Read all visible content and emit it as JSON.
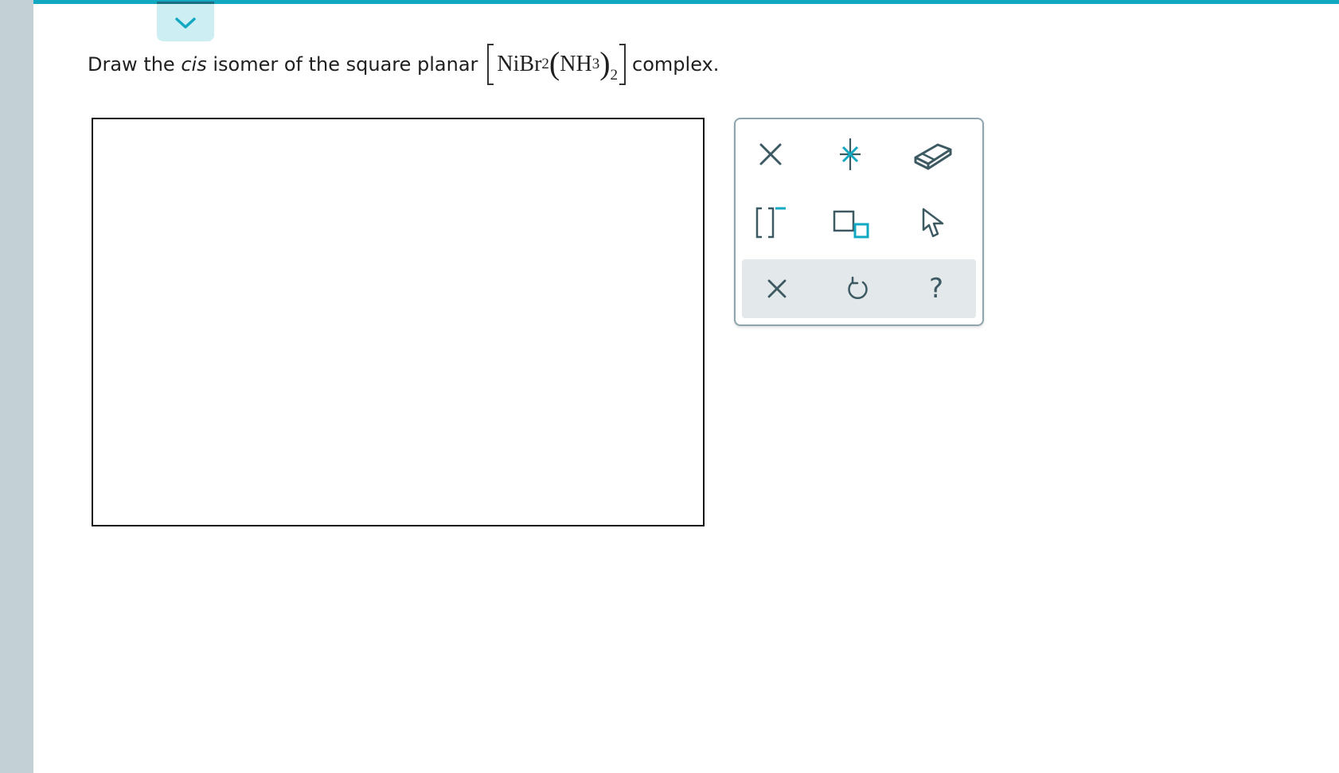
{
  "question": {
    "prefix": "Draw the",
    "italic_word": "cis",
    "middle": "isomer of the square planar",
    "suffix": "complex."
  },
  "formula": {
    "metal_ligand": "NiBr",
    "ligand_count": "2",
    "ammine": "NH",
    "ammine_atoms": "3",
    "ammine_count": "2"
  },
  "toolbox": {
    "tools": [
      {
        "name": "bond-cross-tool",
        "icon": "x-icon"
      },
      {
        "name": "atom-star-tool",
        "icon": "starburst-icon"
      },
      {
        "name": "eraser-tool",
        "icon": "eraser-icon"
      },
      {
        "name": "bracket-charge-tool",
        "icon": "bracket-minus-icon"
      },
      {
        "name": "box-template-tool",
        "icon": "boxes-icon"
      },
      {
        "name": "select-pointer-tool",
        "icon": "cursor-icon"
      }
    ],
    "actions": [
      {
        "name": "clear-button",
        "icon": "close-icon"
      },
      {
        "name": "undo-button",
        "icon": "undo-icon"
      },
      {
        "name": "help-button",
        "icon": "help-icon",
        "label": "?"
      }
    ]
  },
  "colors": {
    "accent": "#12a8c2",
    "tab_bg": "#cdeff4",
    "icon": "#3d5a63",
    "rail": "#c3d0d6"
  }
}
